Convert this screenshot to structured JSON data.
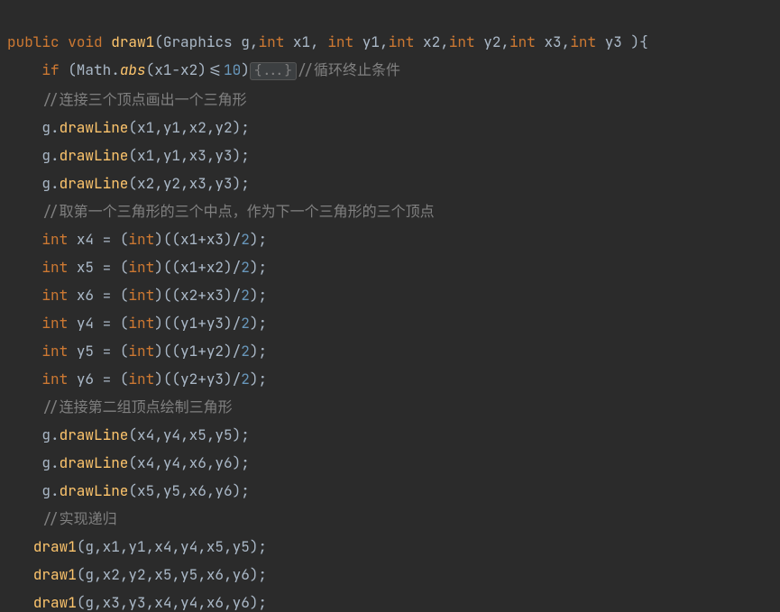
{
  "code": {
    "l1": {
      "kw_public": "public",
      "kw_void": "void",
      "method": "draw1",
      "p_open": "(",
      "type": "Graphics",
      "g": "g",
      "kw_int1": "int",
      "x1": "x1",
      "kw_int2": "int",
      "y1": "y1",
      "kw_int3": "int",
      "x2": "x2",
      "kw_int4": "int",
      "y2": "y2",
      "kw_int5": "int",
      "x3": "x3",
      "kw_int6": "int",
      "y3": "y3",
      "p_close": " ){"
    },
    "l2": {
      "kw_if": "if",
      "open": " (Math.",
      "abs": "abs",
      "args_a": "(x1-x2)<=",
      "ten": "10",
      "args_b": ")",
      "fold": "{...}",
      "cmt": "//循环终止条件"
    },
    "l3": {
      "cmt": "//连接三个顶点画出一个三角形"
    },
    "l4": {
      "pre": "g.",
      "m": "drawLine",
      "args": "(x1,y1,x2,y2);"
    },
    "l5": {
      "pre": "g.",
      "m": "drawLine",
      "args": "(x1,y1,x3,y3);"
    },
    "l6": {
      "pre": "g.",
      "m": "drawLine",
      "args": "(x2,y2,x3,y3);"
    },
    "l7": {
      "cmt": "//取第一个三角形的三个中点，作为下一个三角形的三个顶点"
    },
    "l8": {
      "kw": "int",
      "v": " x4 = (",
      "cast": "int",
      "mid": ")((x1+x3)/",
      "two": "2",
      "end": ");"
    },
    "l9": {
      "kw": "int",
      "v": " x5 = (",
      "cast": "int",
      "mid": ")((x1+x2)/",
      "two": "2",
      "end": ");"
    },
    "l10": {
      "kw": "int",
      "v": " x6 = (",
      "cast": "int",
      "mid": ")((x2+x3)/",
      "two": "2",
      "end": ");"
    },
    "l11": {
      "kw": "int",
      "v": " y4 = (",
      "cast": "int",
      "mid": ")((y1+y3)/",
      "two": "2",
      "end": ");"
    },
    "l12": {
      "kw": "int",
      "v": " y5 = (",
      "cast": "int",
      "mid": ")((y1+y2)/",
      "two": "2",
      "end": ");"
    },
    "l13": {
      "kw": "int",
      "v": " y6 = (",
      "cast": "int",
      "mid": ")((y2+y3)/",
      "two": "2",
      "end": ");"
    },
    "l14": {
      "cmt": "//连接第二组顶点绘制三角形"
    },
    "l15": {
      "pre": "g.",
      "m": "drawLine",
      "args": "(x4,y4,x5,y5);"
    },
    "l16": {
      "pre": "g.",
      "m": "drawLine",
      "args": "(x4,y4,x6,y6);"
    },
    "l17": {
      "pre": "g.",
      "m": "drawLine",
      "args": "(x5,y5,x6,y6);"
    },
    "l18": {
      "cmt": "//实现递归"
    },
    "l19": {
      "m": "draw1",
      "args": "(g,x1,y1,x4,y4,x5,y5);"
    },
    "l20": {
      "m": "draw1",
      "args": "(g,x2,y2,x5,y5,x6,y6);"
    },
    "l21": {
      "m": "draw1",
      "args": "(g,x3,y3,x4,y4,x6,y6);"
    }
  }
}
